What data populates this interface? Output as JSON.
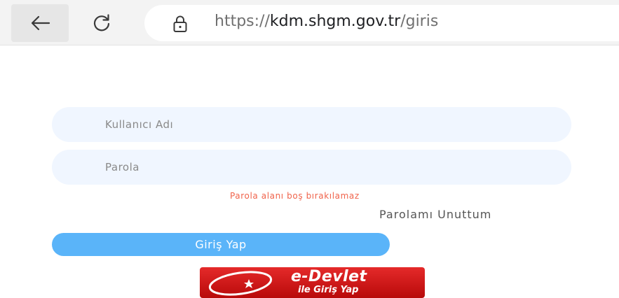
{
  "browser": {
    "back_icon": "arrow-left-icon",
    "reload_icon": "reload-icon",
    "lock_icon": "lock-icon",
    "url_scheme": "https://",
    "url_domain": "kdm.shgm.gov.tr",
    "url_path": "/giris"
  },
  "login": {
    "username_placeholder": "Kullanıcı Adı",
    "password_placeholder": "Parola",
    "error_message": "Parola alanı boş bırakılamaz",
    "forgot_password": "Parolamı Unuttum",
    "submit_label": "Giriş Yap",
    "edevlet_title": "e-Devlet",
    "edevlet_subtitle": "ile Giriş Yap"
  },
  "colors": {
    "field_bg": "#f0f6ff",
    "submit_bg": "#5ab4f9",
    "error": "#f0634b",
    "edevlet_red": "#d81e1e"
  }
}
